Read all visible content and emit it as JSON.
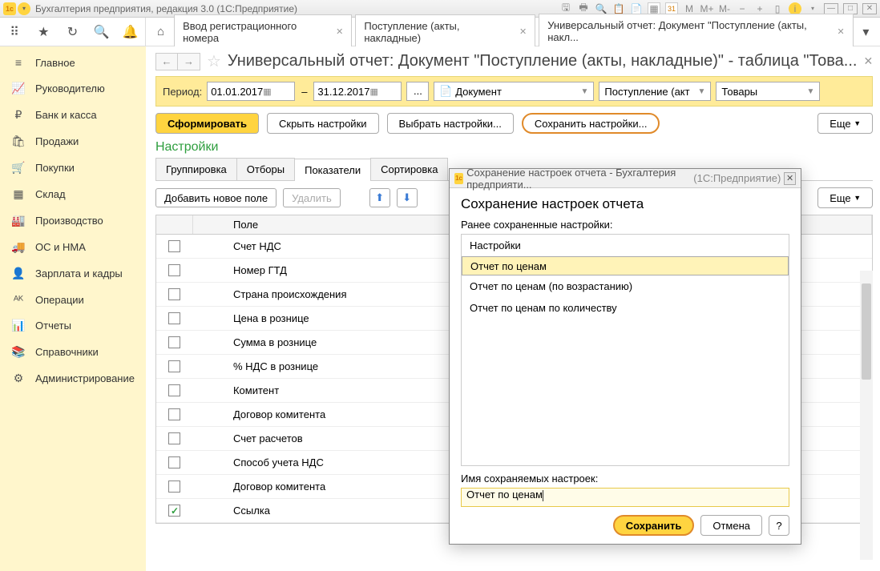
{
  "titlebar": {
    "title": "Бухгалтерия предприятия, редакция 3.0  (1С:Предприятие)",
    "m_labels": [
      "M",
      "M+",
      "M-"
    ]
  },
  "tabs": [
    {
      "label": "Ввод регистрационного номера",
      "active": false
    },
    {
      "label": "Поступление (акты, накладные)",
      "active": false
    },
    {
      "label": "Универсальный отчет: Документ \"Поступление (акты, накл...",
      "active": true
    }
  ],
  "sidebar": [
    {
      "icon": "≡",
      "label": "Главное"
    },
    {
      "icon": "📈",
      "label": "Руководителю"
    },
    {
      "icon": "₽",
      "label": "Банк и касса"
    },
    {
      "icon": "🛍",
      "label": "Продажи"
    },
    {
      "icon": "🛒",
      "label": "Покупки"
    },
    {
      "icon": "▦",
      "label": "Склад"
    },
    {
      "icon": "🏭",
      "label": "Производство"
    },
    {
      "icon": "🚚",
      "label": "ОС и НМА"
    },
    {
      "icon": "👤",
      "label": "Зарплата и кадры"
    },
    {
      "icon": "ᴬᴷ",
      "label": "Операции"
    },
    {
      "icon": "📊",
      "label": "Отчеты"
    },
    {
      "icon": "📚",
      "label": "Справочники"
    },
    {
      "icon": "⚙",
      "label": "Администрирование"
    }
  ],
  "page": {
    "title": "Универсальный отчет: Документ \"Поступление (акты, накладные)\" - таблица \"Това..."
  },
  "period": {
    "label": "Период:",
    "from": "01.01.2017",
    "to": "31.12.2017",
    "type_icon": "📄",
    "type": "Документ",
    "doc": "Поступление (акт",
    "table": "Товары"
  },
  "buttons": {
    "form": "Сформировать",
    "hide": "Скрыть настройки",
    "choose": "Выбрать настройки...",
    "save": "Сохранить настройки...",
    "more": "Еще"
  },
  "settings": {
    "title": "Настройки",
    "tabs": [
      "Группировка",
      "Отборы",
      "Показатели",
      "Сортировка"
    ],
    "active_tab": 2,
    "add": "Добавить новое поле",
    "del": "Удалить",
    "col": "Поле",
    "rows": [
      {
        "checked": false,
        "field": "Счет НДС"
      },
      {
        "checked": false,
        "field": "Номер ГТД"
      },
      {
        "checked": false,
        "field": "Страна происхождения"
      },
      {
        "checked": false,
        "field": "Цена в рознице"
      },
      {
        "checked": false,
        "field": "Сумма в рознице"
      },
      {
        "checked": false,
        "field": "% НДС в рознице"
      },
      {
        "checked": false,
        "field": "Комитент"
      },
      {
        "checked": false,
        "field": "Договор комитента"
      },
      {
        "checked": false,
        "field": "Счет расчетов"
      },
      {
        "checked": false,
        "field": "Способ учета НДС"
      },
      {
        "checked": false,
        "field": "Договор комитента"
      },
      {
        "checked": true,
        "field": "Ссылка"
      }
    ]
  },
  "dialog": {
    "wintitle": "Сохранение настроек отчета - Бухгалтерия предприяти...",
    "winsrc": "(1С:Предприятие)",
    "heading": "Сохранение настроек отчета",
    "saved_label": "Ранее сохраненные настройки:",
    "items": [
      {
        "label": "Настройки",
        "selected": false
      },
      {
        "label": "Отчет по ценам",
        "selected": true
      },
      {
        "label": "Отчет по ценам (по возрастанию)",
        "selected": false
      },
      {
        "label": "Отчет по ценам по количеству",
        "selected": false
      }
    ],
    "name_label": "Имя сохраняемых настроек:",
    "name_value": "Отчет по ценам",
    "save": "Сохранить",
    "cancel": "Отмена",
    "help": "?"
  }
}
